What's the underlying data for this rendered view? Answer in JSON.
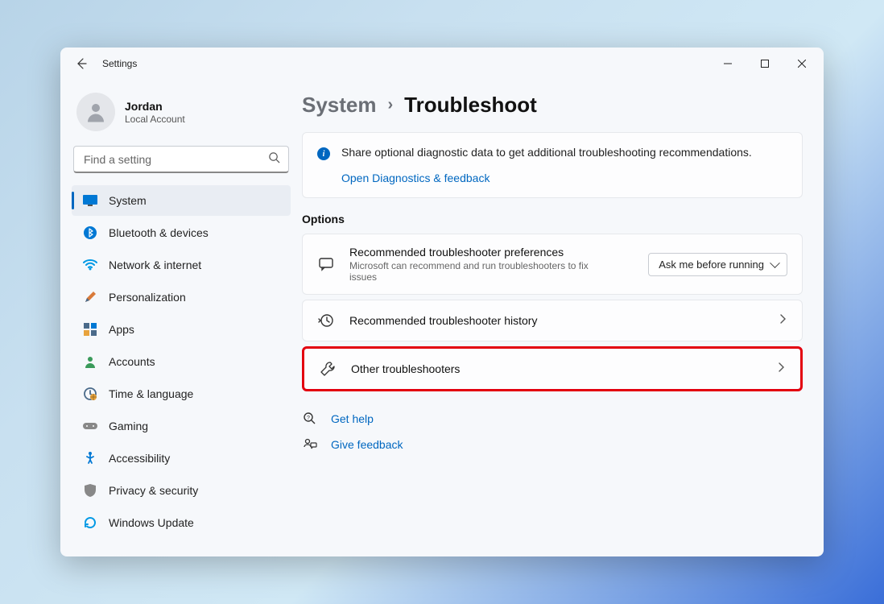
{
  "titlebar": {
    "title": "Settings"
  },
  "profile": {
    "name": "Jordan",
    "account_type": "Local Account"
  },
  "search": {
    "placeholder": "Find a setting"
  },
  "sidebar": {
    "items": [
      {
        "label": "System",
        "icon": "system"
      },
      {
        "label": "Bluetooth & devices",
        "icon": "bluetooth"
      },
      {
        "label": "Network & internet",
        "icon": "wifi"
      },
      {
        "label": "Personalization",
        "icon": "brush"
      },
      {
        "label": "Apps",
        "icon": "apps"
      },
      {
        "label": "Accounts",
        "icon": "person"
      },
      {
        "label": "Time & language",
        "icon": "clock"
      },
      {
        "label": "Gaming",
        "icon": "gamepad"
      },
      {
        "label": "Accessibility",
        "icon": "accessibility"
      },
      {
        "label": "Privacy & security",
        "icon": "shield"
      },
      {
        "label": "Windows Update",
        "icon": "update"
      }
    ],
    "active_index": 0
  },
  "breadcrumb": {
    "parent": "System",
    "current": "Troubleshoot"
  },
  "info_card": {
    "text": "Share optional diagnostic data to get additional troubleshooting recommendations.",
    "link_text": "Open Diagnostics & feedback"
  },
  "options_title": "Options",
  "options": {
    "pref": {
      "title": "Recommended troubleshooter preferences",
      "subtitle": "Microsoft can recommend and run troubleshooters to fix issues",
      "dropdown_value": "Ask me before running"
    },
    "history": {
      "title": "Recommended troubleshooter history"
    },
    "other": {
      "title": "Other troubleshooters"
    }
  },
  "footer": {
    "help": "Get help",
    "feedback": "Give feedback"
  }
}
